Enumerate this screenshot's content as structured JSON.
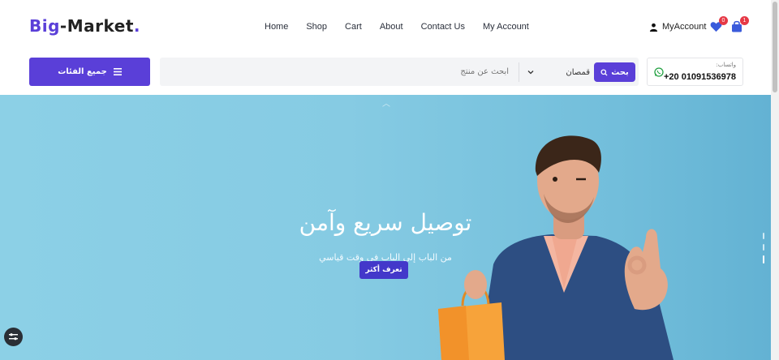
{
  "logo": {
    "part1": "Big",
    "part2": "-Market",
    "dot": "."
  },
  "nav": {
    "items": [
      "Home",
      "Shop",
      "Cart",
      "About",
      "Contact Us",
      "My Account"
    ]
  },
  "account": {
    "label": "MyAccount",
    "wishlist_count": "0",
    "cart_count": "1"
  },
  "categories_button": {
    "label": "جميع الفئات"
  },
  "search": {
    "placeholder": "ابحث عن منتج",
    "category_selected": "قمصان",
    "button_label": "بحث"
  },
  "contact": {
    "label": "واتساب:",
    "phone": "+20 01091536978"
  },
  "hero": {
    "title": "توصيل سريع وآمن",
    "subtitle": "من الباب إلى الباب في وقت قياسي",
    "button_label": "تعرف أكثر"
  },
  "colors": {
    "accent": "#5a3fd8",
    "hero_bg": "#86cbe3",
    "badge": "#e63946"
  },
  "icons": [
    "user-icon",
    "heart-icon",
    "bag-icon",
    "menu-icon",
    "search-icon",
    "chevron-down-icon",
    "whatsapp-icon",
    "settings-icon"
  ]
}
